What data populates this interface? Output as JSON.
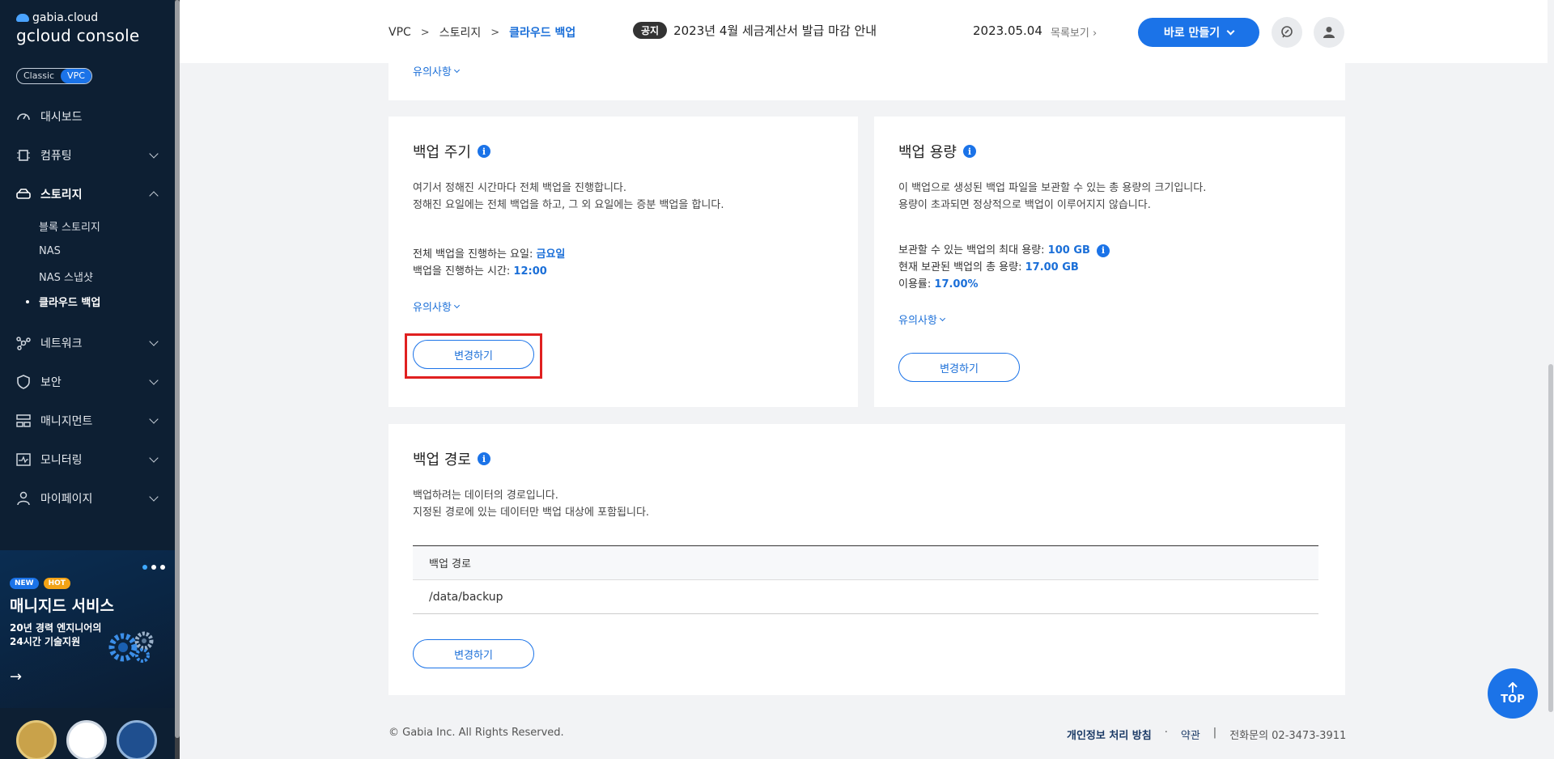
{
  "brand": {
    "small": "gabia.cloud",
    "big": "gcloud console"
  },
  "mode_toggle": {
    "classic": "Classic",
    "vpc": "VPC"
  },
  "sidebar": {
    "items": [
      {
        "label": "대시보드",
        "icon": "dashboard-icon"
      },
      {
        "label": "컴퓨팅",
        "icon": "chip-icon"
      },
      {
        "label": "스토리지",
        "icon": "storage-icon"
      },
      {
        "label": "네트워크",
        "icon": "network-icon"
      },
      {
        "label": "보안",
        "icon": "shield-icon"
      },
      {
        "label": "매니지먼트",
        "icon": "management-icon"
      },
      {
        "label": "모니터링",
        "icon": "monitor-icon"
      },
      {
        "label": "마이페이지",
        "icon": "user-icon"
      }
    ],
    "storage_sub": [
      "블록 스토리지",
      "NAS",
      "NAS 스냅샷",
      "클라우드 백업"
    ]
  },
  "promo": {
    "badge_new": "NEW",
    "badge_hot": "HOT",
    "title": "매니지드 서비스",
    "line1": "20년 경력 엔지니어의",
    "line2": "24시간 기술지원",
    "arrow": "→"
  },
  "header": {
    "breadcrumb": [
      "VPC",
      "스토리지",
      "클라우드 백업"
    ],
    "separator": ">",
    "notice_tag": "공지",
    "notice_text": "2023년 4월 세금계산서 발급 마감 안내",
    "notice_date": "2023.05.04",
    "notice_list": "목록보기",
    "create_button": "바로 만들기"
  },
  "top_card": {
    "more": "유의사항"
  },
  "backup_cycle": {
    "title": "백업 주기",
    "desc1": "여기서 정해진 시간마다 전체 백업을 진행합니다.",
    "desc2": "정해진 요일에는 전체 백업을 하고, 그 외 요일에는 증분 백업을 합니다.",
    "day_label": "전체 백업을 진행하는 요일: ",
    "day_value": "금요일",
    "time_label": "백업을 진행하는 시간: ",
    "time_value": "12:00",
    "more": "유의사항",
    "change": "변경하기"
  },
  "backup_capacity": {
    "title": "백업 용량",
    "desc1": "이 백업으로 생성된 백업 파일을 보관할 수 있는 총 용량의 크기입니다.",
    "desc2": "용량이 초과되면 정상적으로 백업이 이루어지지 않습니다.",
    "max_label": "보관할 수 있는 백업의 최대 용량: ",
    "max_value": "100 GB",
    "total_label": "현재 보관된 백업의 총 용량: ",
    "total_value": "17.00 GB",
    "usage_label": "이용률: ",
    "usage_value": "17.00%",
    "more": "유의사항",
    "change": "변경하기"
  },
  "backup_path": {
    "title": "백업 경로",
    "desc1": "백업하려는 데이터의 경로입니다.",
    "desc2": "지정된 경로에 있는 데이터만 백업 대상에 포함됩니다.",
    "column": "백업 경로",
    "rows": [
      "/data/backup"
    ],
    "change": "변경하기"
  },
  "footer": {
    "copyright": "© Gabia Inc. All Rights Reserved.",
    "privacy": "개인정보 처리 방침",
    "dot": "·",
    "terms": "약관",
    "bar": "|",
    "contact": "전화문의  02-3473-3911"
  },
  "top_button": "TOP"
}
